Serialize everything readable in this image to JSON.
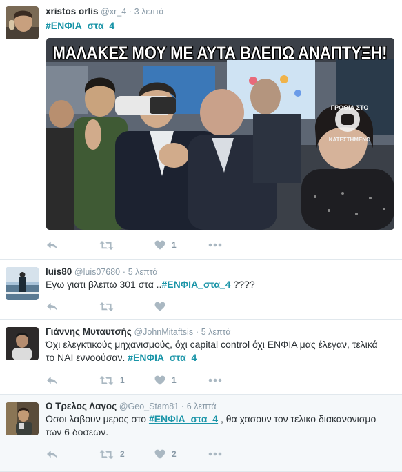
{
  "colors": {
    "hashtag": "#1b95a8",
    "muted": "#8899a6",
    "icon": "#aab8c2",
    "text": "#292f33"
  },
  "tweets": [
    {
      "fullname": "xristos orlis",
      "username": "@xr_4",
      "time": "3 λεπτά",
      "hashtag": "#ΕΝΦΙΑ_στα_4",
      "image_banner": "ΜΑΛΑΚΕΣ ΜΟΥ ΜΕ ΑΥΤΑ ΒΛΕΠΩ ΑΝΑΠΤΥΞΗ!",
      "image_logo_top": "ΓΡΟΘΙΑ ΣΤΟ",
      "image_logo_bottom": "ΚΑΤΕΣΤΗΜΕΝΟ",
      "retweets": "",
      "likes": "1"
    },
    {
      "fullname": "luis80",
      "username": "@luis07680",
      "time": "5 λεπτά",
      "text_before": "Εγω γιατι βλεπω 301 στα ..",
      "hashtag": "#ΕΝΦΙΑ_στα_4",
      "text_after": " ????",
      "retweets": "",
      "likes": ""
    },
    {
      "fullname": "Γιάννης Μυταυτσής",
      "username": "@JohnMitaftsis",
      "time": "5 λεπτά",
      "text_line1": "Όχι ελεγκτικούς μηχανισμούς, όχι capital control όχι ΕΝΦΙΑ μας έλεγαν, τελικά",
      "text_line2": "το ΝΑΙ εννοούσαν. ",
      "hashtag": "#ΕΝΦΙΑ_στα_4",
      "retweets": "1",
      "likes": "1"
    },
    {
      "fullname": "Ο Τρελος Λαγος",
      "username": "@Geo_Stam81",
      "time": "6 λεπτά",
      "text_before": "Οσοι λαβουν μερος στο ",
      "hashtag": "#ΕΝΦΙΑ_στα_4",
      "text_after": " , θα χασουν τον τελικο διακανονισμο",
      "text_line2": "των 6 δοσεων.",
      "retweets": "2",
      "likes": "2"
    }
  ]
}
